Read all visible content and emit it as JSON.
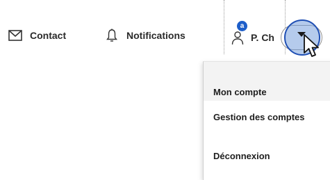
{
  "nav": {
    "contact_label": "Contact",
    "notifications_label": "Notifications",
    "user": {
      "name": "P. Ch",
      "badge": "a"
    }
  },
  "dropdown": {
    "items": [
      {
        "label": "Mon compte"
      },
      {
        "label": "Gestion des comptes"
      },
      {
        "label": "Déconnexion"
      }
    ]
  },
  "icons": {
    "contact": "envelope-icon",
    "notifications": "bell-icon",
    "user": "user-icon",
    "toggle": "caret-down-icon",
    "pointer": "mouse-cursor-icon"
  },
  "colors": {
    "accent": "#1d5ec9",
    "highlight_ring": "#1f4fb4",
    "text": "#2a2a2a"
  }
}
